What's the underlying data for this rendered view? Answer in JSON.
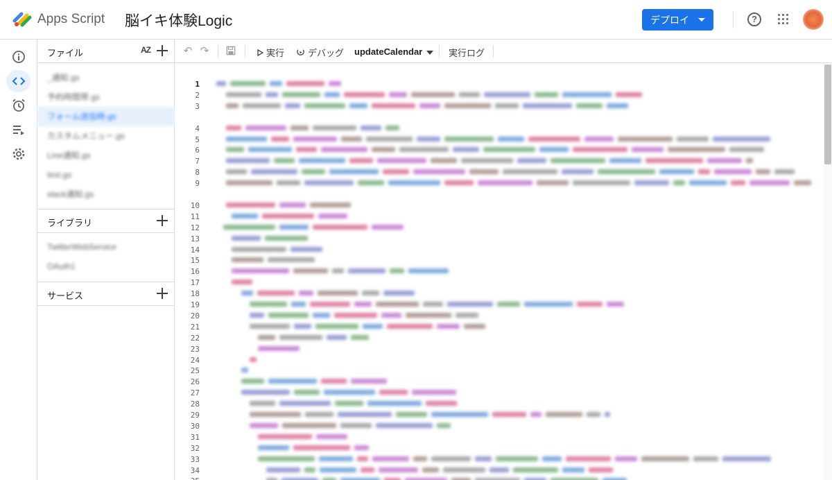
{
  "header": {
    "app_name": "Apps Script",
    "project_title": "脳イキ体験Logic",
    "deploy_label": "デプロイ",
    "help_icon": "help-circle-icon",
    "apps_icon": "apps-grid-icon",
    "avatar_icon": "user-avatar",
    "brand_color": "#1a73e8"
  },
  "rail": {
    "items": [
      {
        "name": "overview",
        "icon": "info-icon"
      },
      {
        "name": "editor",
        "icon": "code-icon",
        "active": true
      },
      {
        "name": "triggers",
        "icon": "alarm-icon"
      },
      {
        "name": "executions",
        "icon": "executions-icon"
      },
      {
        "name": "settings",
        "icon": "gear-icon"
      }
    ]
  },
  "files_panel": {
    "files_title": "ファイル",
    "sort_label": "AZ",
    "files": [
      "_通知.gs",
      "予約時間帯.gs",
      "フォーム送信時.gs",
      "カスタムメニュー.gs",
      "Line通知.gs",
      "test.gs",
      "slack通知.gs"
    ],
    "active_file_index": 2,
    "libraries_title": "ライブラリ",
    "libraries": [
      "TwitterWebService",
      "OAuth1"
    ],
    "services_title": "サービス"
  },
  "toolbar": {
    "undo_icon": "undo-icon",
    "redo_icon": "redo-icon",
    "save_icon": "save-icon",
    "run_label": "実行",
    "debug_label": "デバッグ",
    "function_select": "updateCalendar",
    "log_label": "実行ログ"
  },
  "editor": {
    "line_numbers": [
      "1",
      "2",
      "3",
      "",
      "4",
      "5",
      "6",
      "7",
      "8",
      "9",
      "",
      "10",
      "11",
      "12",
      "13",
      "14",
      "15",
      "16",
      "17",
      "18",
      "19",
      "20",
      "21",
      "22",
      "23",
      "24",
      "25",
      "26",
      "27",
      "28",
      "29",
      "30",
      "31",
      "32",
      "33",
      "34",
      "35",
      "36"
    ],
    "active_line": "1"
  }
}
